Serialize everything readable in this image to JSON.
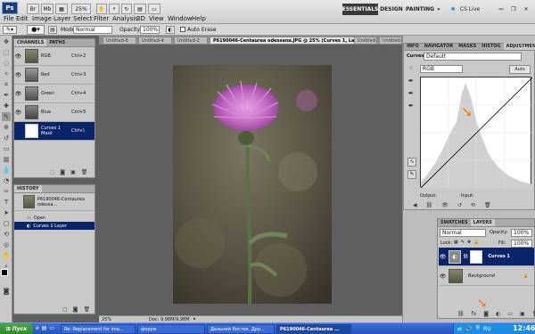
{
  "app": {
    "logo": "Ps",
    "zoom": "25%"
  },
  "menu": [
    "File",
    "Edit",
    "Image",
    "Layer",
    "Select",
    "Filter",
    "Analysis",
    "3D",
    "View",
    "Window",
    "Help"
  ],
  "workspaces": {
    "essentials": "ESSENTIALS",
    "design": "DESIGN",
    "painting": "PAINTING",
    "more": "»",
    "cs_live": "CS Live"
  },
  "options": {
    "mode_label": "Mode:",
    "mode_value": "Normal",
    "opacity_label": "Opacity:",
    "opacity_value": "100%",
    "auto_erase": "Auto Erase"
  },
  "channels": {
    "tabs": [
      "CHANNELS",
      "PATHS"
    ],
    "rows": [
      {
        "name": "RGB",
        "key": "Ctrl+2"
      },
      {
        "name": "Red",
        "key": "Ctrl+3"
      },
      {
        "name": "Green",
        "key": "Ctrl+4"
      },
      {
        "name": "Blue",
        "key": "Ctrl+5"
      },
      {
        "name": "Curves 1 Mask",
        "key": "Ctrl+\\"
      }
    ]
  },
  "history": {
    "tab": "HISTORY",
    "snapshot": "P6190046-Centaurea odessa...",
    "rows": [
      "Open",
      "Curves 1 Layer"
    ]
  },
  "doc_tabs": [
    "Untitled-6",
    "Untitled-4",
    "Untitled-2",
    "P6190046-Centaurea odessana.JPG @ 25% (Curves 1, Layer Mask/8) *",
    "Untitled-7",
    "Untitled-3"
  ],
  "status": {
    "zoom": "25%",
    "doc": "Doc: 9,98M/9,98M"
  },
  "adjust": {
    "tabs": [
      "INFO",
      "NAVIGATOR",
      "MASKS",
      "HISTOG",
      "ADJUSTMENTS"
    ],
    "title": "Curves",
    "preset": "Default",
    "channel": "RGB",
    "auto": "Auto",
    "output": "Output:",
    "input": "Input:"
  },
  "layers": {
    "tabs": [
      "SWATCHES",
      "LAYERS"
    ],
    "blend": "Normal",
    "opacity_label": "Opacity:",
    "opacity": "100%",
    "lock": "Lock:",
    "fill_label": "Fill:",
    "fill": "100%",
    "rows": [
      {
        "name": "Curves 1",
        "selected": true
      },
      {
        "name": "Background",
        "selected": false
      }
    ]
  },
  "taskbar": {
    "start": "Пуск",
    "tasks": [
      "Re: Replacement for ima...",
      "форум",
      "Дальний Восток. Дру...",
      "P6190046-Centaurea ..."
    ],
    "clock": "12:46"
  },
  "colors": {
    "selection": "#0a246a",
    "taskbar": "#2554b8",
    "annotation_arrow": "#f07c1a"
  }
}
